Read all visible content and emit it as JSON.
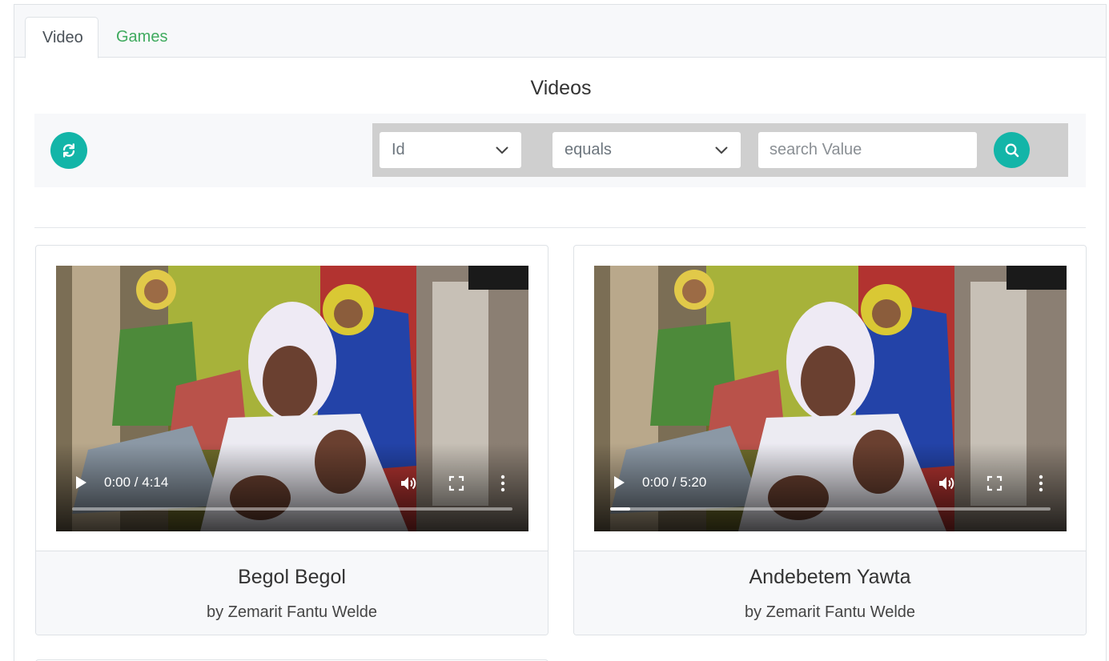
{
  "tabs": [
    {
      "label": "Video",
      "active": true
    },
    {
      "label": "Games",
      "active": false
    }
  ],
  "page_title": "Videos",
  "toolbar": {
    "refresh_icon": "refresh-icon",
    "field_select": {
      "selected": "Id",
      "icon": "chevron-down-icon"
    },
    "operator_select": {
      "selected": "equals",
      "icon": "chevron-down-icon"
    },
    "search": {
      "value": "",
      "placeholder": "search Value"
    },
    "search_icon": "search-icon"
  },
  "videos": [
    {
      "title": "Begol Begol",
      "subtitle": "by Zemarit Fantu Welde",
      "time": "0:00 / 4:14",
      "progress": 0.0
    },
    {
      "title": "Andebetem Yawta",
      "subtitle": "by Zemarit Fantu Welde",
      "time": "0:00 / 5:20",
      "progress": 0.045
    }
  ],
  "colors": {
    "accent": "#13b5a8",
    "tab_link": "#3faa5e",
    "toolbar_bg": "#f7f8fa",
    "filter_bg": "#cfcfcf"
  }
}
